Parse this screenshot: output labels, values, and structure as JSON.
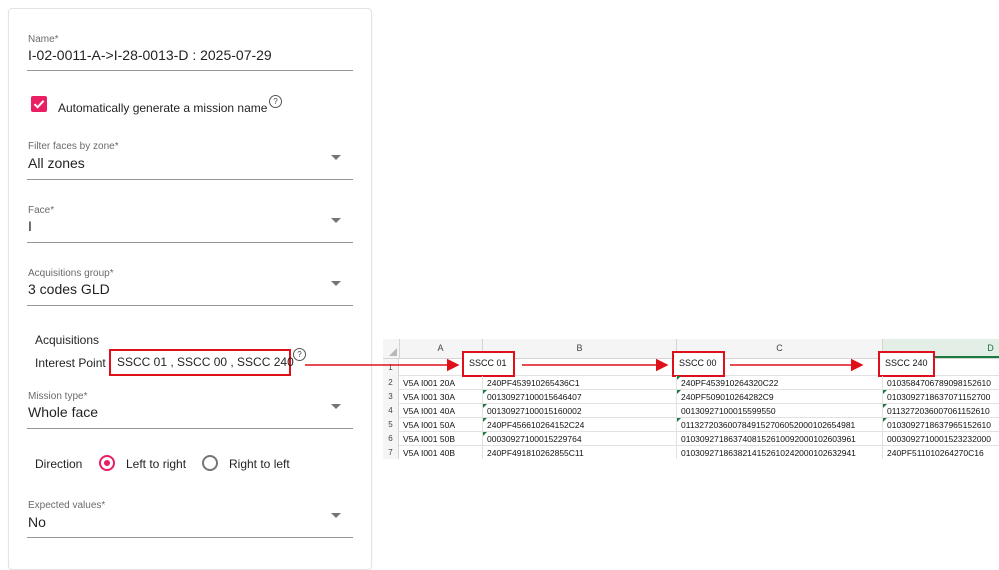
{
  "form": {
    "name": {
      "label": "Name*",
      "value": "I-02-0011-A->I-28-0013-D : 2025-07-29"
    },
    "auto_name": {
      "checked": true,
      "label": "Automatically generate a mission name"
    },
    "filter_zone": {
      "label": "Filter faces by zone*",
      "value": "All zones"
    },
    "face": {
      "label": "Face*",
      "value": "I"
    },
    "acq_group": {
      "label": "Acquisitions group*",
      "value": "3 codes GLD"
    },
    "acquisitions": {
      "title": "Acquisitions",
      "interest_point_label": "Interest Point",
      "interest_point_value": "SSCC 01 , SSCC 00 , SSCC 240"
    },
    "mission_type": {
      "label": "Mission type*",
      "value": "Whole face"
    },
    "direction": {
      "label": "Direction",
      "option_ltr": "Left to right",
      "option_rtl": "Right to left",
      "selected": "Left to right"
    },
    "expected_values": {
      "label": "Expected values*",
      "value": "No"
    },
    "help_glyph": "?"
  },
  "sheet": {
    "columns": [
      "A",
      "B",
      "C",
      "D"
    ],
    "selected_column": "D",
    "header_row": {
      "number": "1",
      "cells": [
        "",
        "SSCC 01",
        "SSCC 00",
        "SSCC 240"
      ]
    },
    "rows": [
      {
        "number": "2",
        "cells": [
          "V5A I001 20A",
          "240PF453910265436C1",
          "240PF453910264320C22",
          "0103584706789098152610"
        ]
      },
      {
        "number": "3",
        "cells": [
          "V5A I001 30A",
          "00130927100015646407",
          "240PF509010264282C9",
          "0103092718637071152700"
        ]
      },
      {
        "number": "4",
        "cells": [
          "V5A I001 40A",
          "00130927100015160002",
          "00130927100015599550",
          "0113272036007061152610"
        ]
      },
      {
        "number": "5",
        "cells": [
          "V5A I001 50A",
          "240PF456610264152C24",
          "0113272036007849152706052000102654981",
          "0103092718637965152610"
        ]
      },
      {
        "number": "6",
        "cells": [
          "V5A I001 50B",
          "00030927100015229764",
          "0103092718637408152610092000102603961",
          "0003092710001523232000"
        ]
      },
      {
        "number": "7",
        "cells": [
          "V5A I001 40B",
          "240PF491810262855C11",
          "0103092718638214152610242000102632941",
          "240PF511010264270C16"
        ]
      }
    ]
  },
  "colors": {
    "accent": "#e91e63",
    "annotation_red": "#e0101b",
    "sheet_green": "#1e7a43"
  }
}
